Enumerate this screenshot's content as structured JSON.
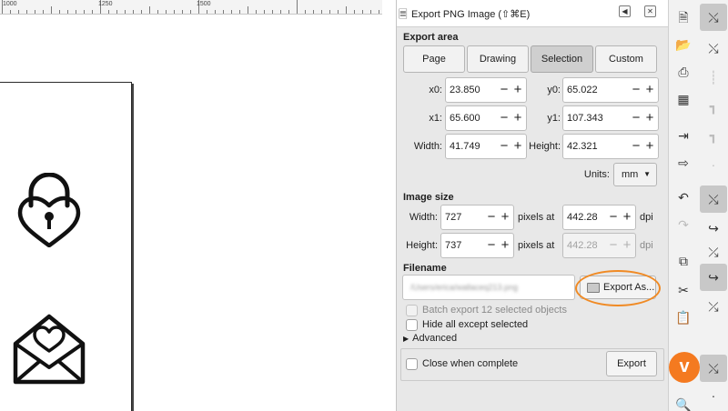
{
  "ruler": {
    "labels": [
      "1000",
      "1250",
      "1500"
    ]
  },
  "dialog": {
    "title": "Export PNG Image (⇧⌘E)",
    "export_area": {
      "heading": "Export area",
      "buttons": [
        "Page",
        "Drawing",
        "Selection",
        "Custom"
      ],
      "selected": "Selection",
      "x0_label": "x0:",
      "x0": "23.850",
      "y0_label": "y0:",
      "y0": "65.022",
      "x1_label": "x1:",
      "x1": "65.600",
      "y1_label": "y1:",
      "y1": "107.343",
      "width_label": "Width:",
      "width": "41.749",
      "height_label": "Height:",
      "height": "42.321",
      "units_label": "Units:",
      "units": "mm"
    },
    "image_size": {
      "heading": "Image size",
      "width_label": "Width:",
      "width": "727",
      "height_label": "Height:",
      "height": "737",
      "pixels_at": "pixels at",
      "dpi_x": "442.28",
      "dpi_y": "442.28",
      "dpi": "dpi"
    },
    "filename": {
      "heading": "Filename",
      "value": "/Users/erica/wallaceq213.png",
      "export_as": "Export As..."
    },
    "options": {
      "batch": "Batch export 12 selected objects",
      "hide": "Hide all except selected",
      "advanced": "Advanced",
      "close_when_complete": "Close when complete",
      "export": "Export"
    }
  },
  "colors": {
    "accent": "#f08a24",
    "dialog_bg": "#e8e8e8",
    "selected_segment": "#cfcfcf"
  },
  "toolbar": {
    "col1_icons": [
      "new-document-icon",
      "open-folder-icon",
      "print-icon",
      "print-preview-icon",
      "import-icon",
      "export-icon",
      "undo-icon",
      "redo-icon",
      "duplicate-icon",
      "cut-icon",
      "paste-icon",
      "zoom-icon",
      "zoom-page-icon"
    ],
    "col2_icons": [
      "snap-toggle-icon",
      "snap-bbox-icon",
      "snap-corner-icon",
      "snap-midpoint-icon",
      "snap-nodes-icon",
      "snap-path-icon",
      "snap-intersection-icon",
      "snap-smooth-icon",
      "snap-center-icon",
      "snap-rotation-icon",
      "snap-guide-icon"
    ]
  }
}
